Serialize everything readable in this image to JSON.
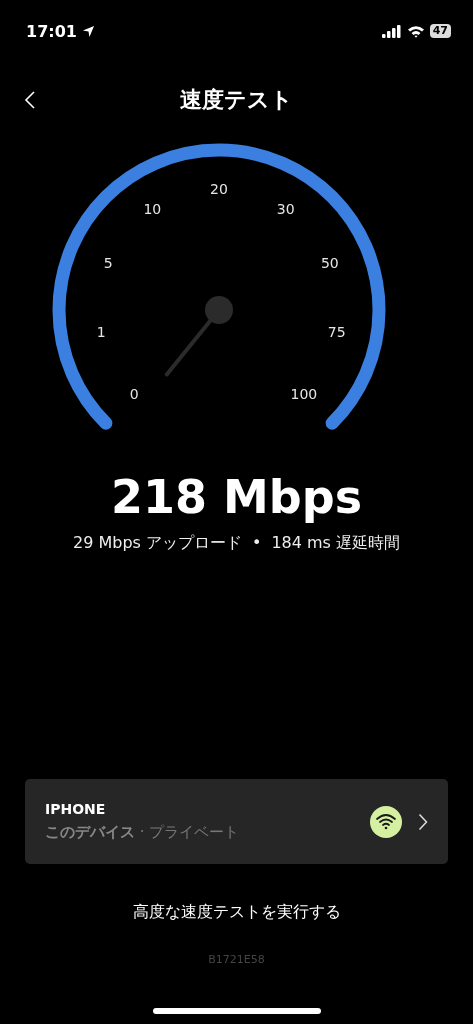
{
  "status_bar": {
    "time": "17:01",
    "battery": "47"
  },
  "header": {
    "title": "速度テスト"
  },
  "gauge": {
    "labels": [
      "0",
      "1",
      "5",
      "10",
      "20",
      "30",
      "50",
      "75",
      "100"
    ]
  },
  "result": {
    "speed": "218 Mbps",
    "upload": "29 Mbps アップロード",
    "separator": "•",
    "latency": "184 ms 遅延時間"
  },
  "device_card": {
    "name": "IPHONE",
    "subtitle": "このデバイス",
    "privacy": "· プライベート"
  },
  "advanced_link": "高度な速度テストを実行する",
  "code": "B1721E58"
}
